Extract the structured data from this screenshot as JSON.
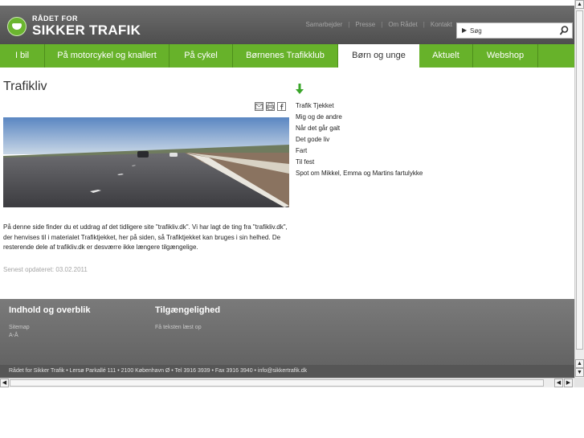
{
  "header": {
    "logo_small": "RÅDET FOR",
    "logo_big": "SIKKER TRAFIK",
    "top_links": [
      "Samarbejder",
      "Presse",
      "Om Rådet",
      "Kontakt"
    ],
    "search_placeholder": "Søg"
  },
  "nav": {
    "items": [
      {
        "label": "I bil"
      },
      {
        "label": "På motorcykel og knallert"
      },
      {
        "label": "På cykel"
      },
      {
        "label": "Børnenes Trafikklub"
      },
      {
        "label": "Børn og unge"
      },
      {
        "label": "Aktuelt"
      },
      {
        "label": "Webshop"
      }
    ],
    "active_index": 4
  },
  "main": {
    "title": "Trafikliv",
    "body": "På denne side finder du et uddrag af det tidligere site \"trafikliv.dk\". Vi har lagt de ting fra \"trafikliv.dk\", der henvises til i materialet Trafiktjekket, her på siden, så Trafiktjekket kan bruges i sin helhed. De resterende dele af trafikliv.dk er desværre ikke længere tilgængelige.",
    "updated": "Senest opdateret: 03.02.2011"
  },
  "sidebar": {
    "links": [
      "Trafik Tjekket",
      "Mig og de andre",
      "Når det går galt",
      "Det gode liv",
      "Fart",
      "Til fest",
      "Spot om Mikkel, Emma og Martins fartulykke"
    ]
  },
  "footer": {
    "col1_heading": "Indhold og overblik",
    "col1_links": [
      "Sitemap",
      "A-Å"
    ],
    "col2_heading": "Tilgængelighed",
    "col2_links": [
      "Få teksten læst op"
    ],
    "address": "Rådet for Sikker Trafik • Lersø Parkallé 111 • 2100 København Ø • Tel 3916 3939 • Fax 3916 3940 • info@sikkertrafik.dk"
  },
  "colors": {
    "nav_green": "#67b22a",
    "header_grey": "#5e5e5e",
    "footer_grey": "#6d6d6d"
  },
  "icons": [
    "crown-logo-icon",
    "search-icon",
    "email-icon",
    "print-icon",
    "facebook-icon",
    "green-down-arrow-icon"
  ]
}
